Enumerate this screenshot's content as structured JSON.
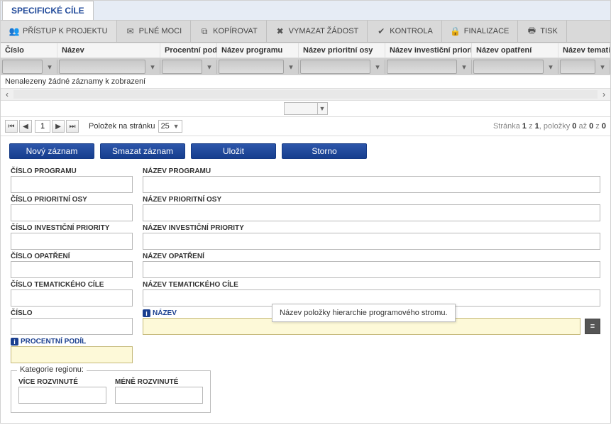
{
  "tab_title": "SPECIFICKÉ CÍLE",
  "toolbar": {
    "pristup": "PŘÍSTUP K PROJEKTU",
    "plnemoci": "PLNÉ MOCI",
    "kopirovat": "KOPÍROVAT",
    "vymazat": "VYMAZAT ŽÁDOST",
    "kontrola": "KONTROLA",
    "finalizace": "FINALIZACE",
    "tisk": "TISK"
  },
  "grid": {
    "cols": {
      "cislo": "Číslo",
      "nazev": "Název",
      "procentni": "Procentní podíl",
      "program": "Název programu",
      "osa": "Název prioritní osy",
      "inv": "Název investiční priority",
      "opatreni": "Název opatření",
      "tematic": "Název tematického"
    },
    "noRecords": "Nenalezeny žádné záznamy k zobrazení",
    "pager": {
      "page": "1",
      "perPageLabel": "Položek na stránku",
      "perPage": "25",
      "info_a": "Stránka ",
      "info_b": "1",
      "info_c": " z ",
      "info_d": "1",
      "info_e": ", položky ",
      "info_f": "0",
      "info_g": " až ",
      "info_h": "0",
      "info_i": " z ",
      "info_j": "0"
    }
  },
  "actions": {
    "novy": "Nový záznam",
    "smazat": "Smazat záznam",
    "ulozit": "Uložit",
    "storno": "Storno"
  },
  "form": {
    "cislo_programu": "ČÍSLO PROGRAMU",
    "nazev_programu": "NÁZEV PROGRAMU",
    "cislo_osy": "ČÍSLO PRIORITNÍ OSY",
    "nazev_osy": "NÁZEV PRIORITNÍ OSY",
    "cislo_inv": "ČÍSLO INVESTIČNÍ PRIORITY",
    "nazev_inv": "NÁZEV INVESTIČNÍ PRIORITY",
    "cislo_op": "ČÍSLO OPATŘENÍ",
    "nazev_op": "NÁZEV OPATŘENÍ",
    "cislo_tem": "ČÍSLO TEMATICKÉHO CÍLE",
    "nazev_tem": "NÁZEV TEMATICKÉHO CÍLE",
    "cislo": "ČÍSLO",
    "nazev": "NÁZEV",
    "procentni": "PROCENTNÍ PODÍL",
    "kategorie": "Kategorie regionu:",
    "vice": "VÍCE ROZVINUTÉ",
    "mene": "MÉNĚ ROZVINUTÉ"
  },
  "tooltip": "Název položky hierarchie programového stromu."
}
